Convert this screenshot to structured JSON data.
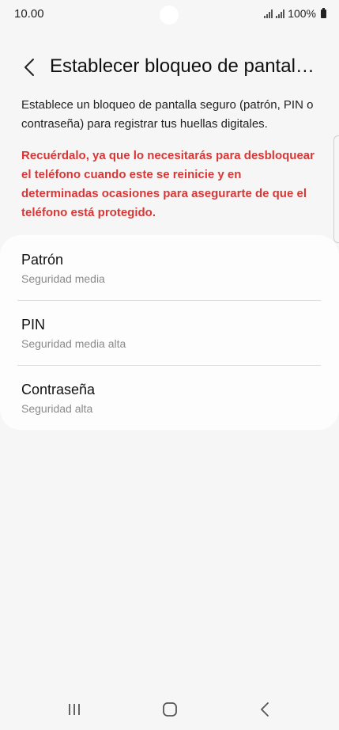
{
  "status_bar": {
    "time": "10.00",
    "battery_text": "100%"
  },
  "header": {
    "title": "Establecer bloqueo de pantall…"
  },
  "description": "Establece un bloqueo de pantalla seguro (patrón, PIN o contraseña) para registrar tus huellas digitales.",
  "warning": "Recuérdalo, ya que lo necesitarás para desbloquear el teléfono cuando este se reinicie y en determinadas ocasiones para asegurarte de que el teléfono está protegido.",
  "options": [
    {
      "title": "Patrón",
      "subtitle": "Seguridad media"
    },
    {
      "title": "PIN",
      "subtitle": "Seguridad media alta"
    },
    {
      "title": "Contraseña",
      "subtitle": "Seguridad alta"
    }
  ],
  "icons": {
    "back": "chevron-left-icon",
    "nav_recents": "recents-icon",
    "nav_home": "home-icon",
    "nav_back": "back-icon"
  },
  "colors": {
    "background": "#f6f6f6",
    "card": "#fdfdfd",
    "warning": "#d93636",
    "subtitle": "#8a8a8a"
  }
}
